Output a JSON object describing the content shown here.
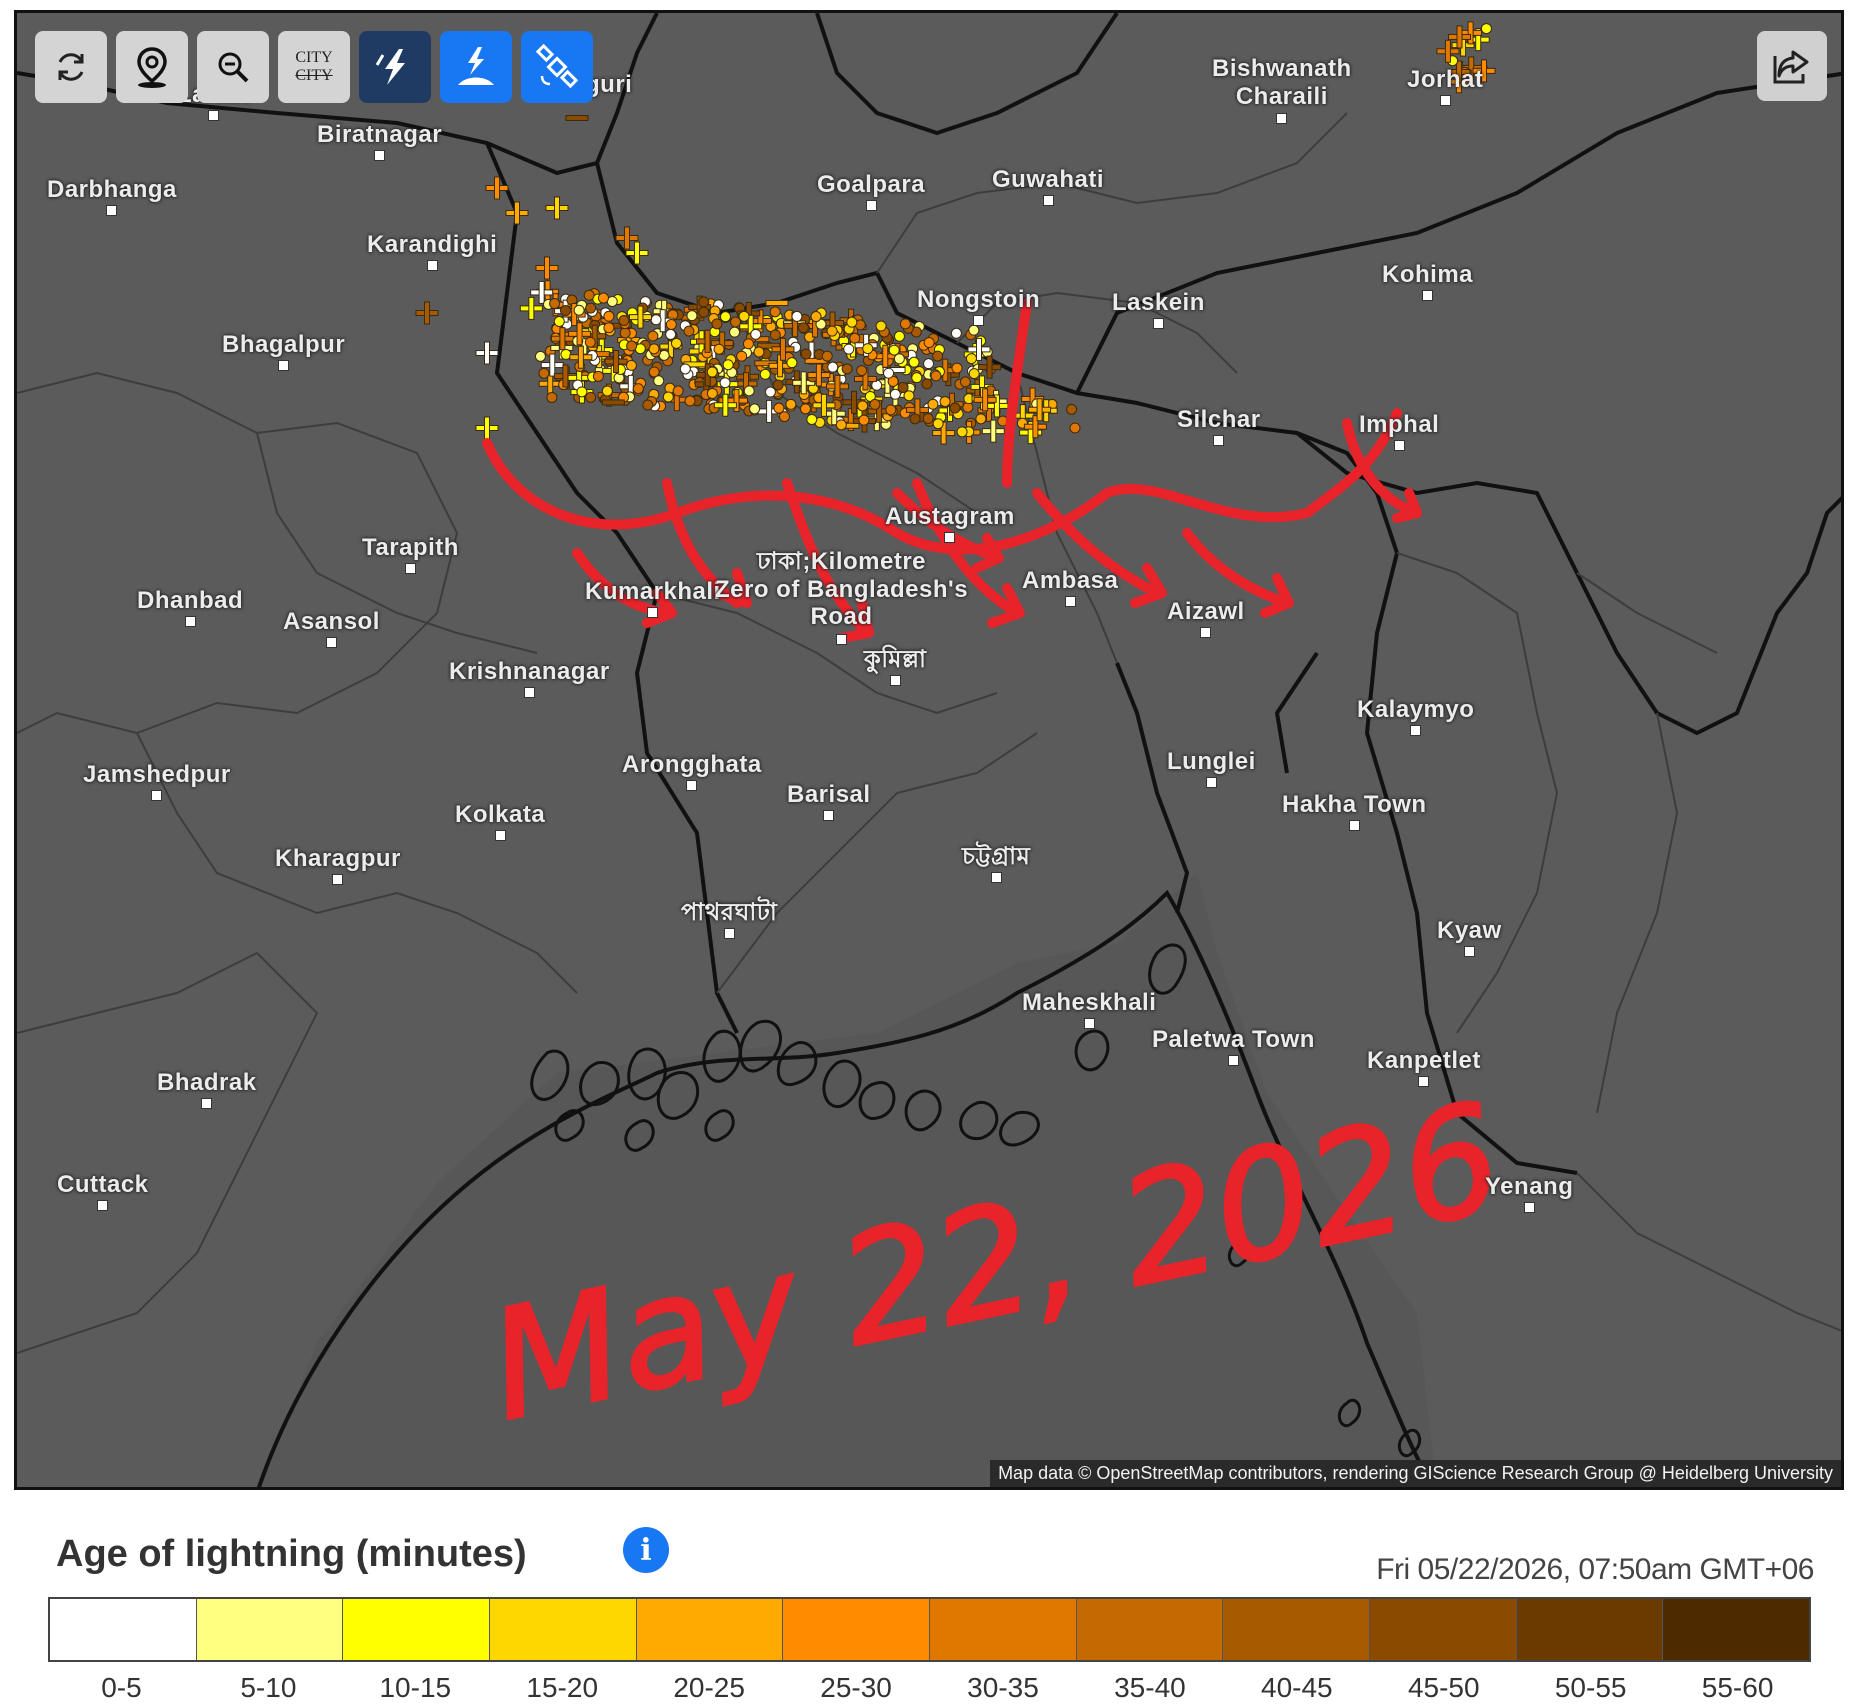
{
  "toolbar": {
    "refresh": "refresh-icon",
    "location": "location-pin-icon",
    "zoom_out": "zoom-out-icon",
    "city_label_top": "CITY",
    "city_label_bottom": "CITY",
    "lightning": "lightning-icon",
    "strike_ground": "ground-strike-icon",
    "satellite": "satellite-icon"
  },
  "share": "share-icon",
  "places": [
    {
      "name": "Lahan",
      "dot": true
    },
    {
      "name": "Siliguri",
      "dot": false
    },
    {
      "name": "Biratnagar",
      "dot": true
    },
    {
      "name": "Darbhanga",
      "dot": true
    },
    {
      "name": "Karandighi",
      "dot": true
    },
    {
      "name": "Bhagalpur",
      "dot": true
    },
    {
      "name": "Goalpara",
      "dot": true
    },
    {
      "name": "Guwahati",
      "dot": true
    },
    {
      "name": "Nongstoin",
      "dot": true
    },
    {
      "name": "Laskein",
      "dot": true
    },
    {
      "name": "Kohima",
      "dot": true
    },
    {
      "name": "Bishwanath\nCharaili",
      "dot": true
    },
    {
      "name": "Jorhat",
      "dot": true
    },
    {
      "name": "Silchar",
      "dot": true
    },
    {
      "name": "Imphal",
      "dot": true
    },
    {
      "name": "Austagram",
      "dot": true
    },
    {
      "name": "Tarapith",
      "dot": true
    },
    {
      "name": "Dhanbad",
      "dot": true
    },
    {
      "name": "Asansol",
      "dot": true
    },
    {
      "name": "Kumarkhali",
      "dot": true
    },
    {
      "name": "ঢাকা;Kilometre\nZero of Bangladesh's\nRoad",
      "dot": true
    },
    {
      "name": "Ambasa",
      "dot": true
    },
    {
      "name": "Aizawl",
      "dot": true
    },
    {
      "name": "কুমিল্লা",
      "dot": true
    },
    {
      "name": "Krishnanagar",
      "dot": true
    },
    {
      "name": "Kalaymyo",
      "dot": true
    },
    {
      "name": "Jamshedpur",
      "dot": true
    },
    {
      "name": "Arongghata",
      "dot": true
    },
    {
      "name": "Barisal",
      "dot": true
    },
    {
      "name": "Lunglei",
      "dot": true
    },
    {
      "name": "Hakha Town",
      "dot": true
    },
    {
      "name": "Kolkata",
      "dot": true
    },
    {
      "name": "Kharagpur",
      "dot": true
    },
    {
      "name": "চট্টগ্রাম",
      "dot": true
    },
    {
      "name": "পাথরঘাটা",
      "dot": true
    },
    {
      "name": "Kyaw",
      "dot": true
    },
    {
      "name": "Maheskhali",
      "dot": true
    },
    {
      "name": "Paletwa Town",
      "dot": true
    },
    {
      "name": "Kanpetlet",
      "dot": true
    },
    {
      "name": "Bhadrak",
      "dot": true
    },
    {
      "name": "Cuttack",
      "dot": true
    },
    {
      "name": "Yenang",
      "dot": true
    }
  ],
  "attribution": "Map data © OpenStreetMap contributors, rendering GIScience Research Group @ Heidelberg University",
  "annotation": {
    "text": "May 22, 2026",
    "color": "#e8232a"
  },
  "legend": {
    "title": "Age of lightning (minutes)",
    "info_icon": "info-icon",
    "timestamp": "Fri 05/22/2026, 07:50am GMT+06",
    "bins": [
      {
        "label": "0-5",
        "color": "#ffffff"
      },
      {
        "label": "5-10",
        "color": "#ffff80"
      },
      {
        "label": "10-15",
        "color": "#ffff00"
      },
      {
        "label": "15-20",
        "color": "#ffd700"
      },
      {
        "label": "20-25",
        "color": "#ffaa00"
      },
      {
        "label": "25-30",
        "color": "#ff8c00"
      },
      {
        "label": "30-35",
        "color": "#e07800"
      },
      {
        "label": "35-40",
        "color": "#c46a00"
      },
      {
        "label": "40-45",
        "color": "#a85a00"
      },
      {
        "label": "45-50",
        "color": "#8a4a00"
      },
      {
        "label": "50-55",
        "color": "#6b3a00"
      },
      {
        "label": "55-60",
        "color": "#4d2a00"
      }
    ]
  }
}
